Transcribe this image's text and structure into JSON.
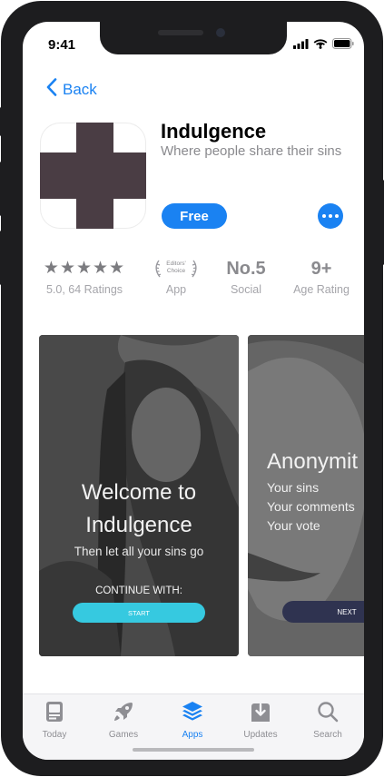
{
  "status_bar": {
    "time": "9:41"
  },
  "nav": {
    "back_label": "Back"
  },
  "app": {
    "name": "Indulgence",
    "subtitle": "Where people share their sins",
    "get_label": "Free"
  },
  "info": {
    "rating_stars": "★★★★★",
    "rating_sub": "5.0, 64 Ratings",
    "editors_choice": "Editors' Choice",
    "editors_sub": "App",
    "rank": "No.5",
    "rank_sub": "Social",
    "age": "9+",
    "age_sub": "Age Rating"
  },
  "screenshots": {
    "first": {
      "welcome_line1": "Welcome to",
      "welcome_line2": "Indulgence",
      "tagline": "Then let all your sins go",
      "continue_label": "CONTINUE WITH:",
      "start_label": "START"
    },
    "second": {
      "heading": "Anonymit",
      "items": [
        "Your sins",
        "Your comments",
        "Your vote"
      ],
      "next_label": "NEXT"
    }
  },
  "tab_bar": {
    "tabs": [
      {
        "label": "Today",
        "icon": "today-icon"
      },
      {
        "label": "Games",
        "icon": "rocket-icon"
      },
      {
        "label": "Apps",
        "icon": "layers-icon"
      },
      {
        "label": "Updates",
        "icon": "download-icon"
      },
      {
        "label": "Search",
        "icon": "search-icon"
      }
    ],
    "active": "Apps"
  },
  "colors": {
    "accent": "#1a82f2",
    "start_button": "#36c9e0",
    "next_button": "#2f3350",
    "cross": "#4a3d44"
  }
}
